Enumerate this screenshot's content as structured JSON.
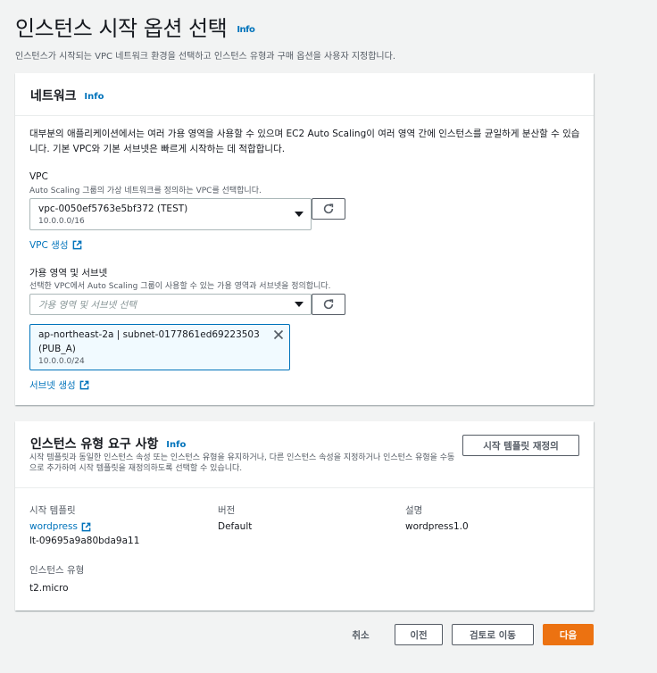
{
  "page": {
    "title": "인스턴스 시작 옵션 선택",
    "info": "Info",
    "description": "인스턴스가 시작되는 VPC 네트워크 환경을 선택하고 인스턴스 유형과 구매 옵션을 사용자 지정합니다."
  },
  "network": {
    "title": "네트워크",
    "info": "Info",
    "description": "대부분의 애플리케이션에서는 여러 가용 영역을 사용할 수 있으며 EC2 Auto Scaling이 여러 영역 간에 인스턴스를 균일하게 분산할 수 있습니다. 기본 VPC와 기본 서브넷은 빠르게 시작하는 데 적합합니다.",
    "vpc": {
      "label": "VPC",
      "sublabel": "Auto Scaling 그룹의 가상 네트워크를 정의하는 VPC를 선택합니다.",
      "value": "vpc-0050ef5763e5bf372 (TEST)",
      "cidr": "10.0.0.0/16",
      "create_link": "VPC 생성"
    },
    "az": {
      "label": "가용 영역 및 서브넷",
      "sublabel": "선택한 VPC에서 Auto Scaling 그룹이 사용할 수 있는 가용 영역과 서브넷을 정의합니다.",
      "placeholder": "가용 영역 및 서브넷 선택",
      "selected": {
        "line1": "ap-northeast-2a | subnet-0177861ed69223503",
        "line2": "(PUB_A)",
        "cidr": "10.0.0.0/24"
      },
      "create_link": "서브넷 생성"
    }
  },
  "instance_type": {
    "title": "인스턴스 유형 요구 사항",
    "info": "Info",
    "description": "시작 템플릿과 동일한 인스턴스 속성 또는 인스턴스 유형을 유지하거나, 다른 인스턴스 속성을 지정하거나 인스턴스 유형을 수동으로 추가하여 시작 템플릿을 재정의하도록 선택할 수 있습니다.",
    "override_button": "시작 템플릿 재정의",
    "template_label": "시작 템플릿",
    "template_name": "wordpress",
    "template_id": "lt-09695a9a80bda9a11",
    "version_label": "버전",
    "version_value": "Default",
    "desc_label": "설명",
    "desc_value": "wordpress1.0",
    "type_label": "인스턴스 유형",
    "type_value": "t2.micro"
  },
  "footer": {
    "cancel": "취소",
    "previous": "이전",
    "review": "검토로 이동",
    "next": "다음"
  },
  "colors": {
    "accent": "#ec7211",
    "link": "#0073bb",
    "background": "#f2f3f3"
  }
}
